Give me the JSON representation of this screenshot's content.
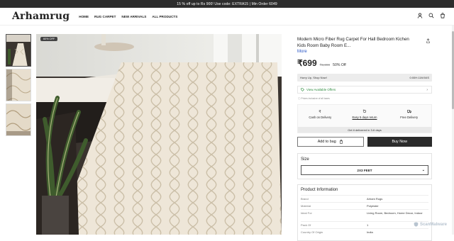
{
  "announcement": "15 % off up to Rs 900! Use code: EXTRA15 | Min Order 6049",
  "brand": "Arhamrug",
  "nav": [
    "HOME",
    "RUG CARPET",
    "NEW ARRIVALS",
    "ALL PRODUCTS"
  ],
  "badge": "60% OFF",
  "product": {
    "title": "Modern Micro Fiber Rug Carpet For Hall Bedroom Kichen Kids Room Baby Room E...",
    "more": "More",
    "price": "₹699",
    "mrp": "₹1,398",
    "discount": "50% Off",
    "hurry": "Hurry Up, Shop Now!",
    "timer": "0:00H:11M:54S",
    "offers_label": "View Available Offers",
    "prices_note": "Prices inclusive of all taxes",
    "services": [
      "Cash on Delivery",
      "Easy 5 days return",
      "Free Delivery"
    ],
    "delivered": "Get it delivered in 3-6 days",
    "add_to_bag": "Add to bag",
    "buy_now": "Buy Now",
    "size_label": "Size",
    "size_value": "2X3 FEET",
    "info_title": "Product Information",
    "info": [
      {
        "k": "Brand",
        "v": "Arham Rugs"
      },
      {
        "k": "Material",
        "v": "Polyester"
      },
      {
        "k": "Ideal For",
        "v": "Living Room, Bedroom, Home Decor, Indoor"
      },
      {
        "k": "Pack Of",
        "v": "1"
      },
      {
        "k": "Country Of Origin",
        "v": "India"
      }
    ]
  },
  "watermark": "ScanMalware",
  "colors": {
    "dark": "#2b2b2b",
    "offer_green": "#2c8b3e",
    "link_blue": "#2a56c6"
  }
}
